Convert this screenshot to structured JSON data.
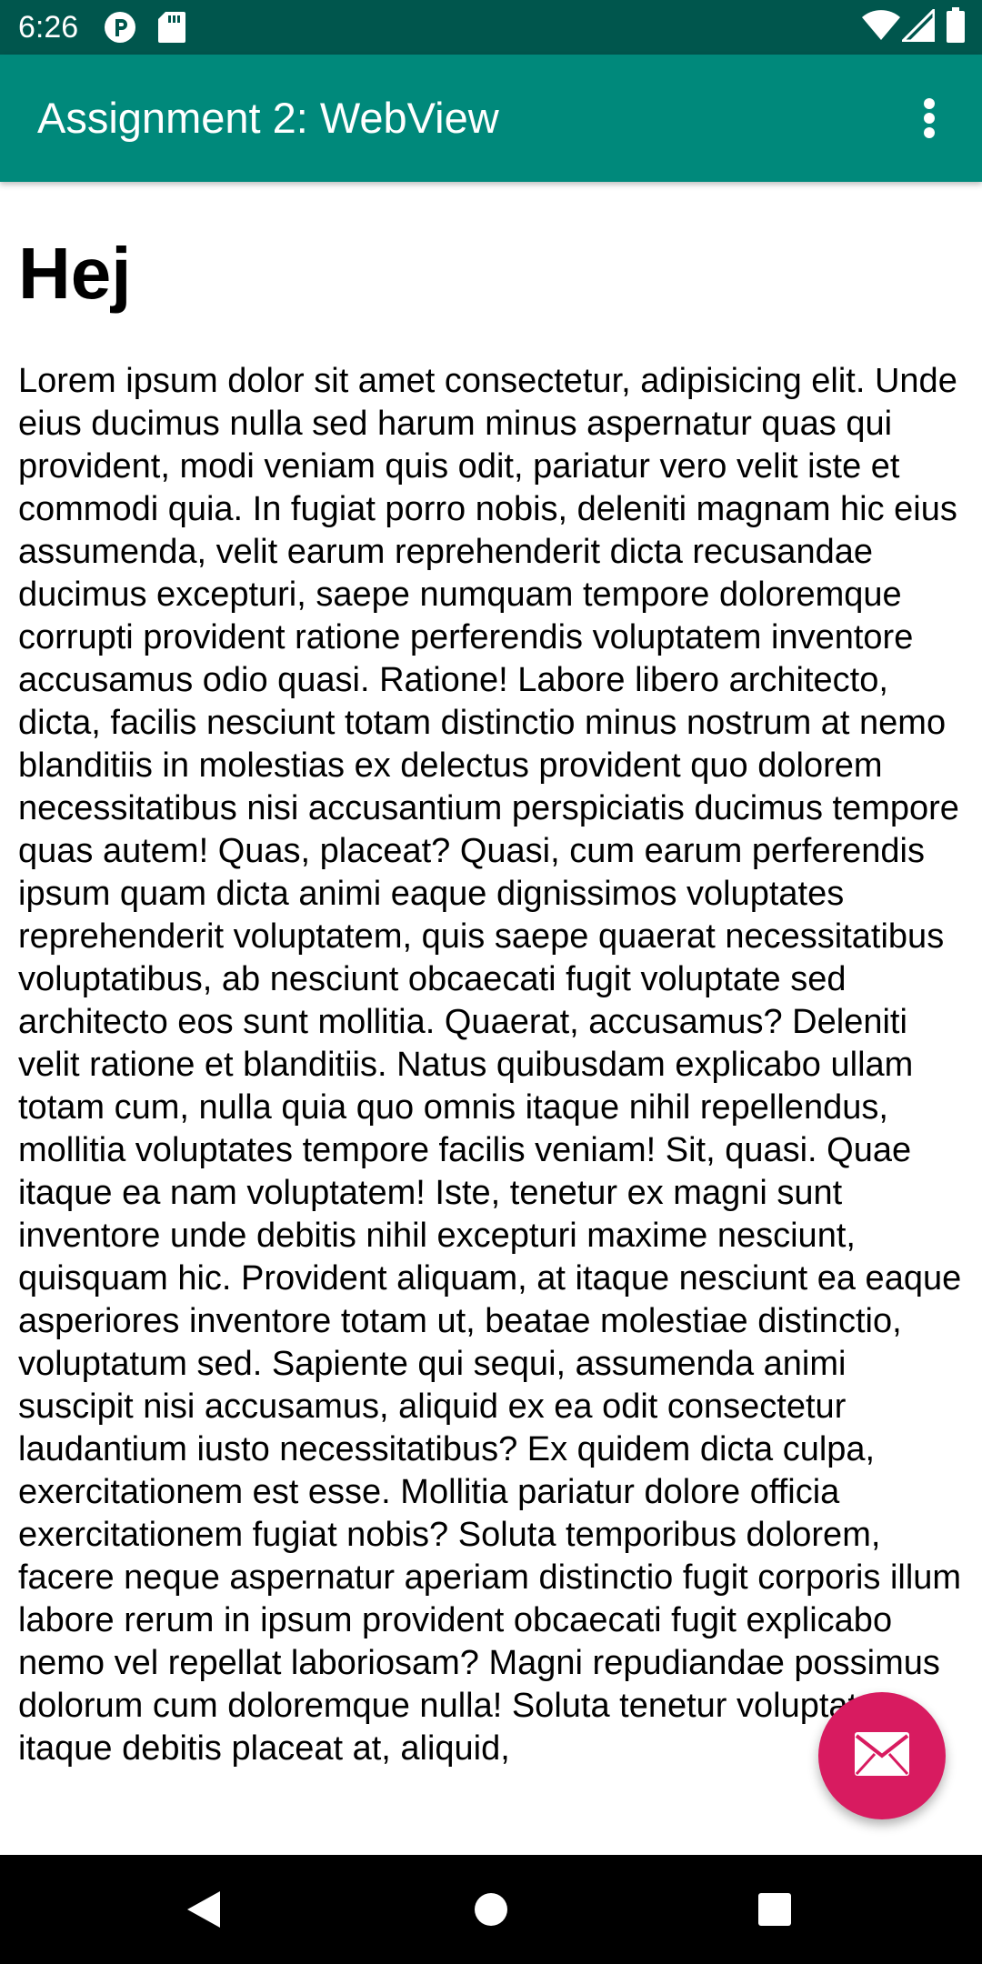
{
  "status_bar": {
    "time": "6:26",
    "left_icons": [
      "p-badge-icon",
      "sd-card-icon"
    ],
    "right_icons": [
      "wifi-icon",
      "cellular-signal-icon",
      "battery-icon"
    ],
    "background": "#00564d"
  },
  "app_bar": {
    "title": "Assignment 2: WebView",
    "overflow_icon": "more-vert-icon",
    "background": "#00897b"
  },
  "web": {
    "heading": "Hej",
    "paragraph": "Lorem ipsum dolor sit amet consectetur, adipisicing elit. Unde eius ducimus nulla sed harum minus aspernatur quas qui provident, modi veniam quis odit, pariatur vero velit iste et commodi quia. In fugiat porro nobis, deleniti magnam hic eius assumenda, velit earum reprehenderit dicta recusandae ducimus excepturi, saepe numquam tempore doloremque corrupti provident ratione perferendis voluptatem inventore accusamus odio quasi. Ratione! Labore libero architecto, dicta, facilis nesciunt totam distinctio minus nostrum at nemo blanditiis in molestias ex delectus provident quo dolorem necessitatibus nisi accusantium perspiciatis ducimus tempore quas autem! Quas, placeat? Quasi, cum earum perferendis ipsum quam dicta animi eaque dignissimos voluptates reprehenderit voluptatem, quis saepe quaerat necessitatibus voluptatibus, ab nesciunt obcaecati fugit voluptate sed architecto eos sunt mollitia. Quaerat, accusamus? Deleniti velit ratione et blanditiis. Natus quibusdam explicabo ullam totam cum, nulla quia quo omnis itaque nihil repellendus, mollitia voluptates tempore facilis veniam! Sit, quasi. Quae itaque ea nam voluptatem! Iste, tenetur ex magni sunt inventore unde debitis nihil excepturi maxime nesciunt, quisquam hic. Provident aliquam, at itaque nesciunt ea eaque asperiores inventore totam ut, beatae molestiae distinctio, voluptatum sed. Sapiente qui sequi, assumenda animi suscipit nisi accusamus, aliquid ex ea odit consectetur laudantium iusto necessitatibus? Ex quidem dicta culpa, exercitationem est esse. Mollitia pariatur dolore officia exercitationem fugiat nobis? Soluta temporibus dolorem, facere neque aspernatur aperiam distinctio fugit corporis illum labore rerum in ipsum provident obcaecati fugit explicabo nemo vel repellat laboriosam? Magni repudiandae possimus dolorum cum doloremque nulla! Soluta tenetur voluptates itaque debitis placeat at, aliquid,"
  },
  "fab": {
    "icon": "email-icon",
    "color": "#d81b60"
  },
  "nav_bar": {
    "buttons": [
      "back-icon",
      "home-icon",
      "recents-icon"
    ]
  }
}
